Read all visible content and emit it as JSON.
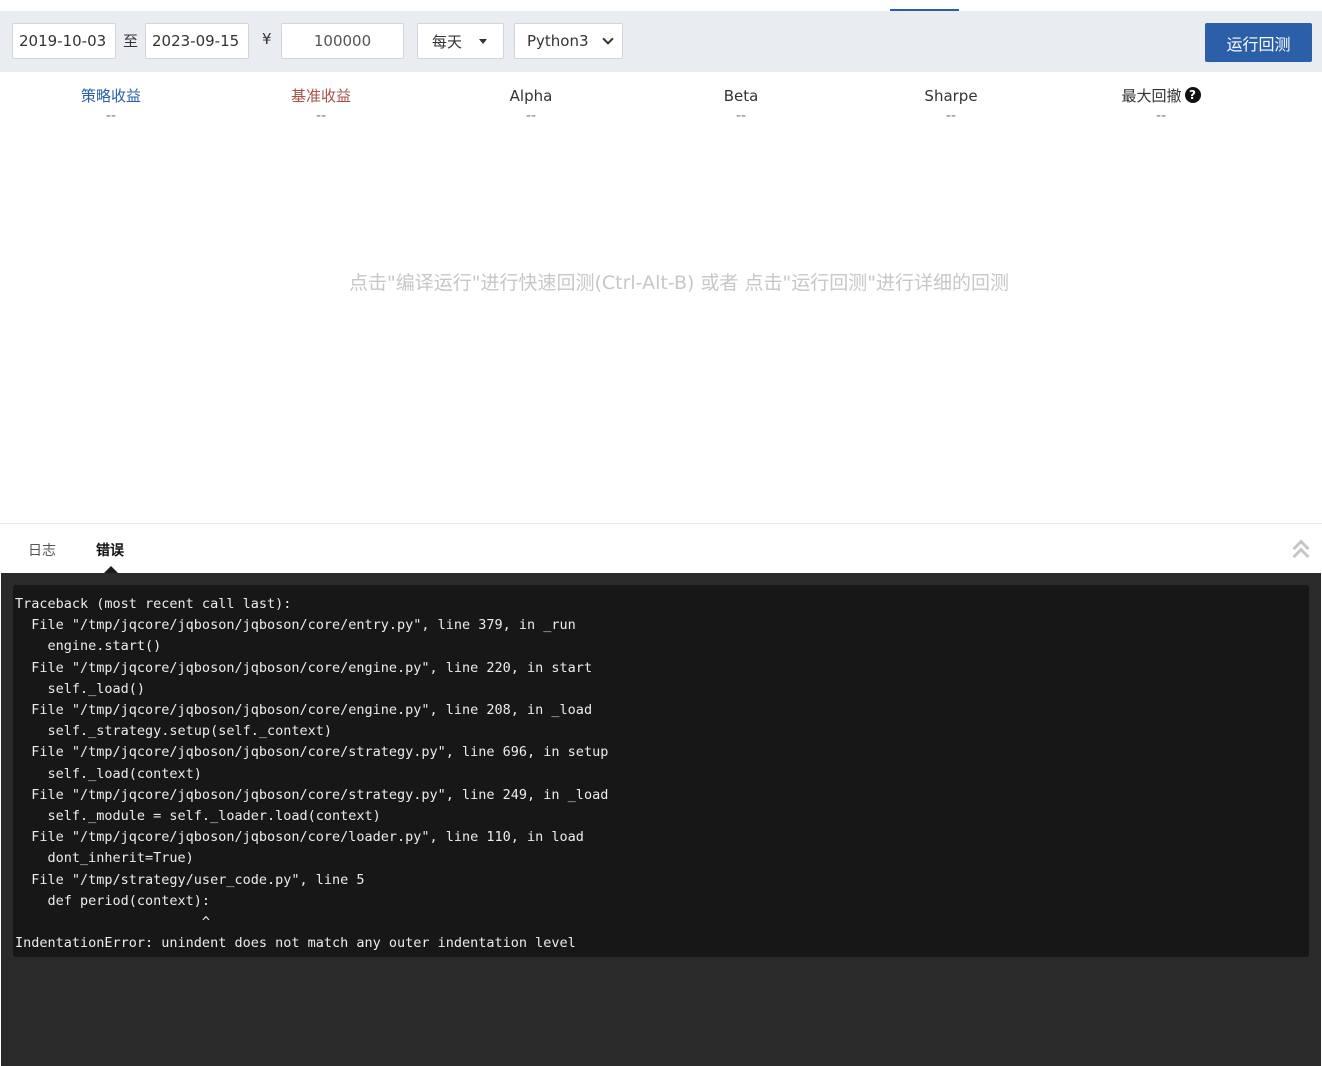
{
  "toolbar": {
    "start_date": "2019-10-03",
    "to_label": "至",
    "end_date": "2023-09-15",
    "currency_symbol": "¥",
    "capital": "100000",
    "frequency": "每天",
    "language": "Python3",
    "run_backtest_label": "运行回测"
  },
  "metrics": {
    "strategy_return": {
      "label": "策略收益",
      "value": "--"
    },
    "benchmark_return": {
      "label": "基准收益",
      "value": "--"
    },
    "alpha": {
      "label": "Alpha",
      "value": "--"
    },
    "beta": {
      "label": "Beta",
      "value": "--"
    },
    "sharpe": {
      "label": "Sharpe",
      "value": "--"
    },
    "max_drawdown": {
      "label": "最大回撤",
      "value": "--",
      "help_glyph": "?"
    }
  },
  "hint": "点击\"编译运行\"进行快速回测(Ctrl-Alt-B) 或者 点击\"运行回测\"进行详细的回测",
  "bottom_panel": {
    "tabs": {
      "log": "日志",
      "error": "错误"
    },
    "active_tab": "错误",
    "error_output": "Traceback (most recent call last):\n  File \"/tmp/jqcore/jqboson/jqboson/core/entry.py\", line 379, in _run\n    engine.start()\n  File \"/tmp/jqcore/jqboson/jqboson/core/engine.py\", line 220, in start\n    self._load()\n  File \"/tmp/jqcore/jqboson/jqboson/core/engine.py\", line 208, in _load\n    self._strategy.setup(self._context)\n  File \"/tmp/jqcore/jqboson/jqboson/core/strategy.py\", line 696, in setup\n    self._load(context)\n  File \"/tmp/jqcore/jqboson/jqboson/core/strategy.py\", line 249, in _load\n    self._module = self._loader.load(context)\n  File \"/tmp/jqcore/jqboson/jqboson/core/loader.py\", line 110, in load\n    dont_inherit=True)\n  File \"/tmp/strategy/user_code.py\", line 5\n    def period(context):\n                       ^\nIndentationError: unindent does not match any outer indentation level"
  },
  "colors": {
    "accent": "#2b5fa8",
    "benchmark": "#a8504a",
    "toolbar_bg": "#e9edf2",
    "console_bg": "#171717"
  },
  "icons": {
    "frequency_dropdown": "caret-down-icon",
    "language_dropdown": "chevron-down-icon",
    "max_drawdown_help": "question-circle-icon",
    "panel_toggle": "double-chevron-up-icon"
  }
}
